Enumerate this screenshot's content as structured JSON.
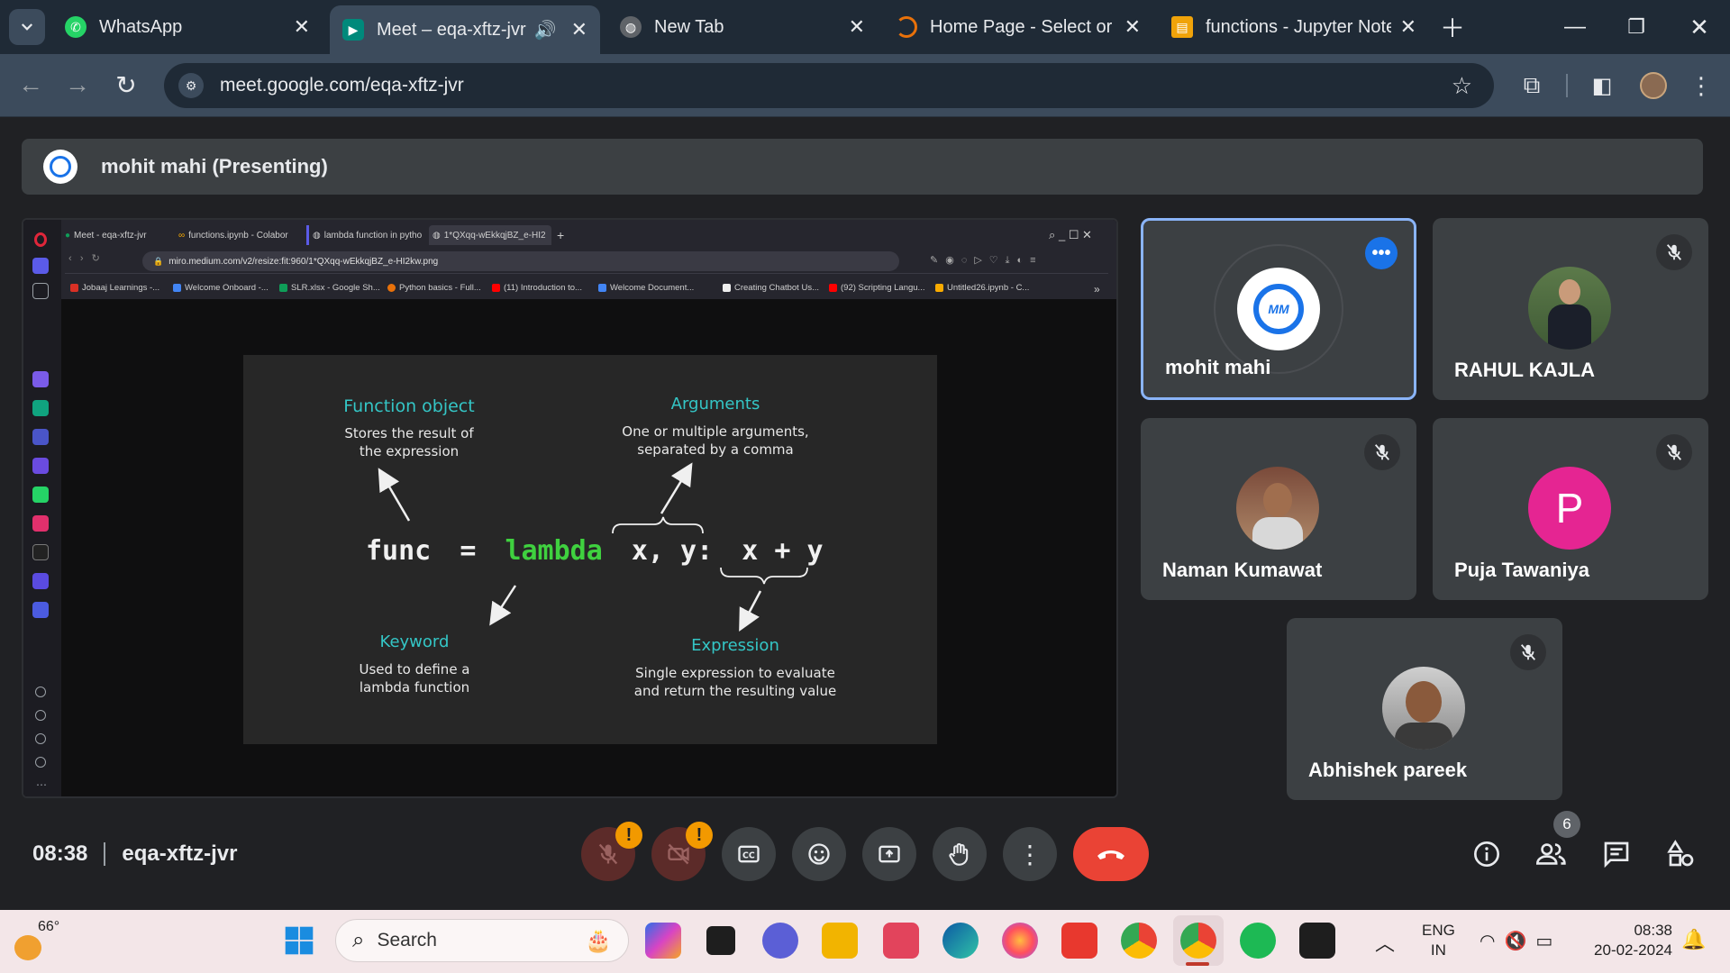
{
  "browser": {
    "tabs": [
      {
        "label": "WhatsApp",
        "icon": "whatsapp-icon",
        "color": "#25d366"
      },
      {
        "label": "Meet – eqa-xftz-jvr",
        "icon": "google-meet-icon",
        "color": "#00897b"
      },
      {
        "label": "New Tab",
        "icon": "globe-icon",
        "color": "#9aa0a6"
      },
      {
        "label": "Home Page - Select or cr",
        "icon": "loading-spinner-icon",
        "color": "#e8710a"
      },
      {
        "label": "functions - Jupyter Noteb",
        "icon": "notebook-icon",
        "color": "#f0a30a"
      }
    ],
    "url": "meet.google.com/eqa-xftz-jvr"
  },
  "meet": {
    "presenter_label": "mohit mahi (Presenting)",
    "participants": [
      {
        "name": "mohit mahi",
        "avatar": "logo",
        "muted": false
      },
      {
        "name": "RAHUL KAJLA",
        "avatar": "photo",
        "muted": true
      },
      {
        "name": "Naman Kumawat",
        "avatar": "photo",
        "muted": true
      },
      {
        "name": "Puja Tawaniya",
        "avatar": "initial",
        "initial": "P",
        "avatar_color": "#e52592",
        "muted": true
      },
      {
        "name": "Abhishek pareek",
        "avatar": "photo",
        "muted": true
      }
    ],
    "time": "08:38",
    "meeting_code": "eqa-xftz-jvr",
    "people_count": "6",
    "warning_badge": "!"
  },
  "shared_screen": {
    "tabs": [
      "Meet - eqa-xftz-jvr",
      "functions.ipynb - Colabor",
      "lambda function in pytho",
      "1*QXqq-wEkkqjBZ_e-HI2"
    ],
    "url": "miro.medium.com/v2/resize:fit:960/1*QXqq-wEkkqjBZ_e-HI2kw.png",
    "bookmarks": [
      "Jobaaj Learnings -...",
      "Welcome Onboard -...",
      "SLR.xlsx - Google Sh...",
      "Python basics - Full...",
      "(11) Introduction to...",
      "Welcome Document...",
      "Creating Chatbot Us...",
      "(92) Scripting Langu...",
      "Untitled26.ipynb - C..."
    ],
    "diagram": {
      "code": {
        "func": "func",
        "eq": "=",
        "lambda": "lambda",
        "args": "x, y:",
        "expr": "x + y"
      },
      "function_object_title": "Function object",
      "function_object_desc": [
        "Stores the result of",
        "the expression"
      ],
      "arguments_title": "Arguments",
      "arguments_desc": [
        "One or multiple arguments,",
        "separated by a comma"
      ],
      "keyword_title": "Keyword",
      "keyword_desc": [
        "Used to define a",
        "lambda function"
      ],
      "expression_title": "Expression",
      "expression_desc": [
        "Single expression to evaluate",
        "and return the resulting value"
      ]
    }
  },
  "taskbar": {
    "weather_temp": "66°",
    "search_placeholder": "Search",
    "language": "ENG",
    "region": "IN",
    "clock_time": "08:38",
    "clock_date": "20-02-2024"
  },
  "colors": {
    "end_call": "#ea4335",
    "active_speaker_border": "#8ab4f8",
    "diagram_teal": "#34c6c6",
    "diagram_green": "#3fd13f"
  }
}
